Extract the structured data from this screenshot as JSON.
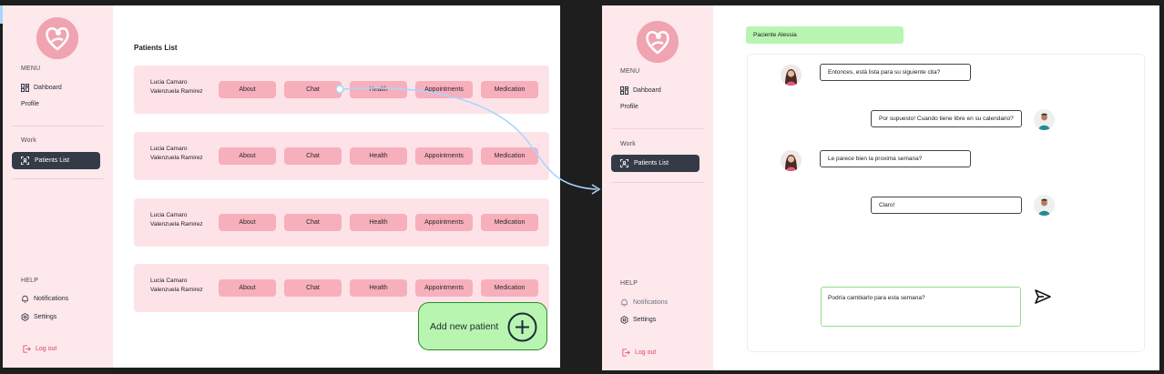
{
  "left_screen": {
    "sidebar": {
      "menu_label": "MENU",
      "dashboard": "Dahboard",
      "profile": "Profile",
      "work_label": "Work",
      "patients_list": "Patients List",
      "help_label": "HELP",
      "notifications": "Notifications",
      "settings": "Settings",
      "logout": "Log out"
    },
    "title": "Patients List",
    "patients": [
      {
        "name": "Lucia Camaro Valenzuela Ramirez"
      },
      {
        "name": "Lucia Camaro Valenzuela Ramirez"
      },
      {
        "name": "Lucia Camaro Valenzuela Ramirez"
      },
      {
        "name": "Lucia Camaro Valenzuela Ramirez"
      }
    ],
    "buttons": [
      "About",
      "Chat",
      "Health",
      "Appointments",
      "Medication"
    ],
    "add_patient": "Add new patient"
  },
  "right_screen": {
    "sidebar": {
      "menu_label": "MENU",
      "dashboard": "Dahboard",
      "profile": "Profile",
      "work_label": "Work",
      "patients_list": "Patients List",
      "help_label": "HELP",
      "notifications": "Notifications",
      "settings": "Settings",
      "logout": "Log out"
    },
    "chat_title": "Paciente Alessia",
    "messages": [
      {
        "from": "patient",
        "text": "Entonces, está lista para su siguiente cita?"
      },
      {
        "from": "doctor",
        "text": "Por supuesto! Cuando tiene libre en su calendario?"
      },
      {
        "from": "patient",
        "text": "Le parece bien la proxima semana?"
      },
      {
        "from": "doctor",
        "text": "Claro!"
      }
    ],
    "composer_text": "Podría cambiarlo para esta semana?"
  },
  "colors": {
    "sidebar_bg": "#fde8ec",
    "accent_pink": "#f7afbc",
    "accent_green": "#b8f5b1",
    "active_nav": "#343b47",
    "logout_red": "#e0445e",
    "flow_arrow": "#a9d6ff"
  },
  "icons": [
    "logo-icon",
    "dashboard-icon",
    "patients-list-icon",
    "bell-icon",
    "gear-icon",
    "logout-icon",
    "plus-circle-icon",
    "send-icon"
  ]
}
